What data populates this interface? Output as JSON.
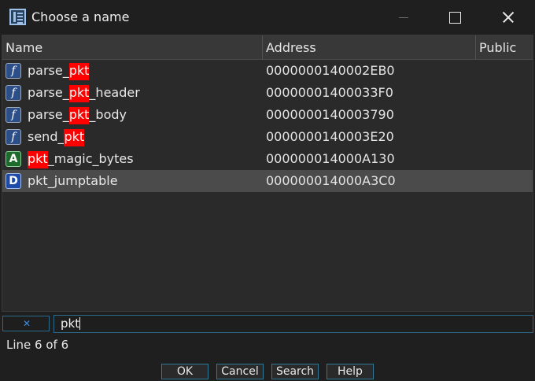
{
  "window": {
    "title": "Choose a name"
  },
  "table": {
    "columns": [
      "Name",
      "Address",
      "Public"
    ],
    "rows": [
      {
        "icon": "function-icon",
        "glyph": "f",
        "pre": "parse_",
        "match": "pkt",
        "post": "",
        "address": "0000000140002EB0"
      },
      {
        "icon": "function-icon",
        "glyph": "f",
        "pre": "parse_",
        "match": "pkt",
        "post": "_header",
        "address": "00000001400033F0"
      },
      {
        "icon": "function-icon",
        "glyph": "f",
        "pre": "parse_",
        "match": "pkt",
        "post": "_body",
        "address": "0000000140003790"
      },
      {
        "icon": "function-icon",
        "glyph": "f",
        "pre": "send_",
        "match": "pkt",
        "post": "",
        "address": "0000000140003E20"
      },
      {
        "icon": "ascii-string-icon",
        "glyph": "A",
        "pre": "",
        "match": "pkt",
        "post": "_magic_bytes",
        "address": "000000014000A130"
      },
      {
        "icon": "data-icon",
        "glyph": "D",
        "pre": "pkt_jumptable",
        "match": "",
        "post": "",
        "address": "000000014000A3C0"
      }
    ],
    "selected_row": 5
  },
  "filter": {
    "clear_glyph": "✕",
    "value": "pkt"
  },
  "status": "Line 6 of 6",
  "buttons": {
    "ok": "OK",
    "cancel": "Cancel",
    "search": "Search",
    "help": "Help"
  },
  "colors": {
    "highlight": "#ff0000",
    "selection": "#4b4b4b",
    "accent_border": "#2d7a96"
  }
}
